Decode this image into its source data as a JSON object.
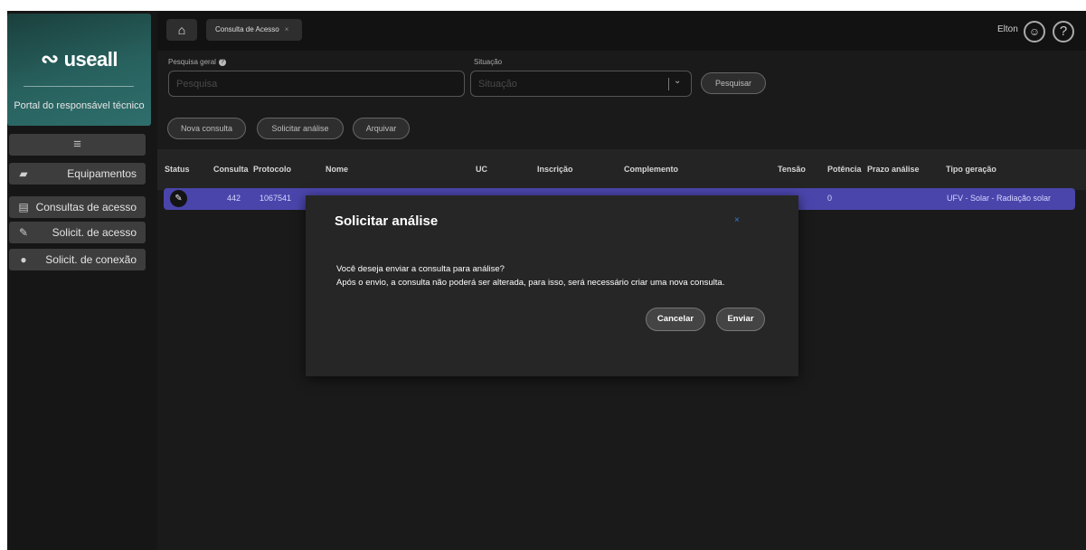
{
  "sidebar": {
    "logo_text": "useall",
    "portal_label": "Portal do responsável técnico",
    "menu_icon": "hamburger-icon",
    "items": [
      {
        "label": "Equipamentos",
        "icon": "equipment-icon"
      },
      {
        "label": "Consultas de acesso",
        "icon": "document-check-icon"
      },
      {
        "label": "Solicit. de acesso",
        "icon": "document-edit-icon"
      },
      {
        "label": "Solicit. de conexão",
        "icon": "lightbulb-icon"
      }
    ]
  },
  "topbar": {
    "home_icon": "home-icon",
    "tab_label": "Consulta de Acesso",
    "tab_close": "×",
    "user_name": "Elton",
    "avatar_icon": "user-avatar-icon",
    "help_icon": "help-icon"
  },
  "filters": {
    "search_label": "Pesquisa geral",
    "search_placeholder": "Pesquisa",
    "situacao_label": "Situação",
    "situacao_placeholder": "Situação",
    "search_button": "Pesquisar"
  },
  "actions": {
    "new": "Nova consulta",
    "request": "Solicitar análise",
    "archive": "Arquivar"
  },
  "table": {
    "headers": [
      "Status",
      "Consulta",
      "Protocolo",
      "Nome",
      "UC",
      "Inscrição",
      "Complemento",
      "Tensão",
      "Potência",
      "Prazo análise",
      "Tipo geração"
    ],
    "row": {
      "consulta": "442",
      "protocolo": "1067541",
      "potencia": "0",
      "tipo_geracao": "UFV - Solar - Radiação solar"
    }
  },
  "modal": {
    "title": "Solicitar análise",
    "close": "×",
    "line1": "Você deseja enviar a consulta para análise?",
    "line2": "Após o envio, a consulta não poderá ser alterada, para isso, será necessário criar uma nova consulta.",
    "cancel": "Cancelar",
    "confirm": "Enviar"
  },
  "colors": {
    "accent_row": "#4a45ab",
    "brand_gradient": "#2e6e6c",
    "close_icon": "#3a7bd5"
  }
}
